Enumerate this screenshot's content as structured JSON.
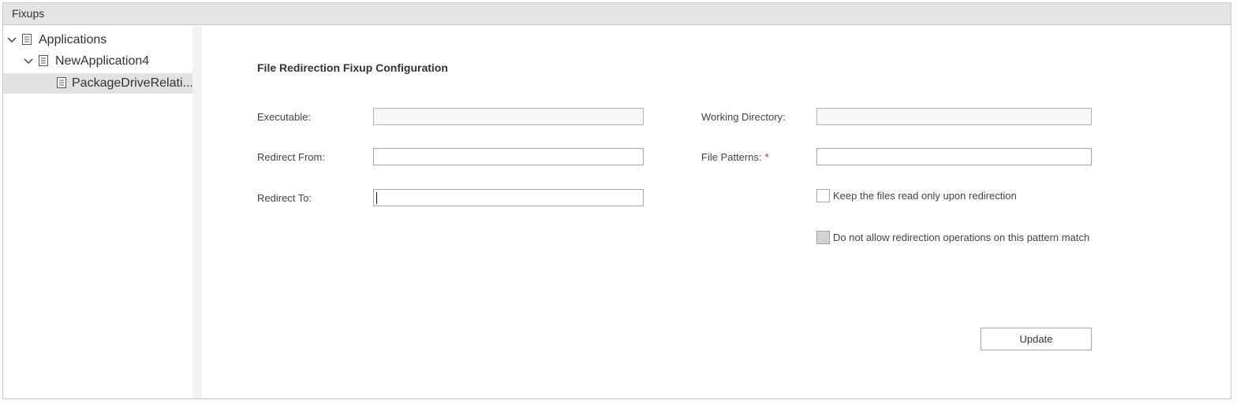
{
  "panel": {
    "title": "Fixups"
  },
  "tree": {
    "nodes": [
      {
        "label": "Applications",
        "expanded": true,
        "icon": "document-icon"
      },
      {
        "label": "NewApplication4",
        "expanded": true,
        "icon": "document-icon"
      },
      {
        "label": "PackageDriveRelati...",
        "selected": true,
        "icon": "document-icon"
      }
    ]
  },
  "form": {
    "title": "File Redirection Fixup Configuration",
    "executable": {
      "label": "Executable:",
      "value": ""
    },
    "working_directory": {
      "label": "Working Directory:",
      "value": ""
    },
    "redirect_from": {
      "label": "Redirect From:",
      "value": ""
    },
    "file_patterns": {
      "label": "File Patterns:",
      "required_mark": "*",
      "value": ""
    },
    "redirect_to": {
      "label": "Redirect To:",
      "value": ""
    },
    "keep_read_only": {
      "label": "Keep the files read only upon redirection",
      "checked": false
    },
    "no_redirection": {
      "label": "Do not allow redirection operations on this pattern match",
      "checked": false,
      "disabled": true
    },
    "update_label": "Update"
  },
  "colors": {
    "header_bg": "#e4e4e4",
    "selected_bg": "#e2e2e2",
    "required": "#e02020"
  }
}
